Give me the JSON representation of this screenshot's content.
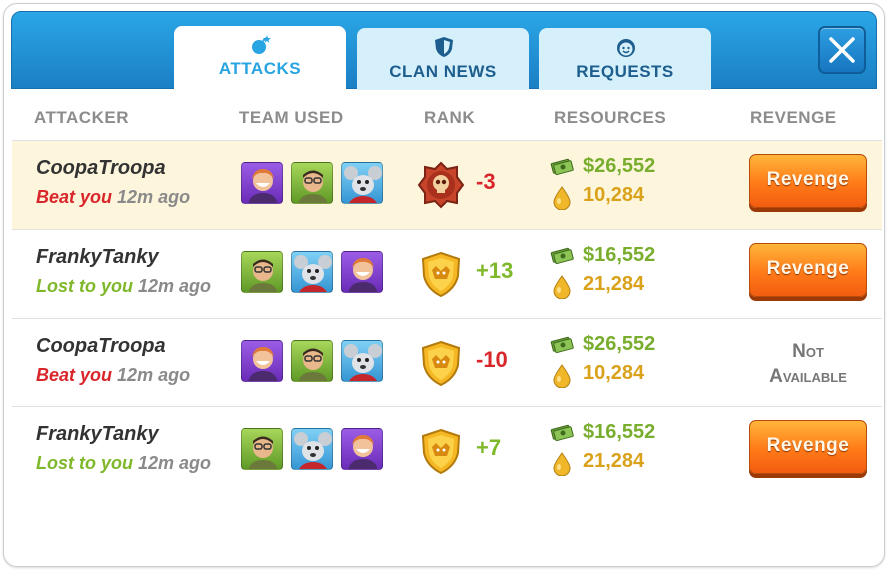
{
  "tabs": [
    {
      "label": "ATTACKS",
      "icon": "bomb-icon",
      "active": true
    },
    {
      "label": "CLAN NEWS",
      "icon": "shield-icon",
      "active": false
    },
    {
      "label": "REQUESTS",
      "icon": "face-icon",
      "active": false
    }
  ],
  "columns": {
    "attacker": "ATTACKER",
    "team_used": "TEAM USED",
    "rank": "RANK",
    "resources": "RESOURCES",
    "revenge": "REVENGE"
  },
  "rows": [
    {
      "name": "CoopaTroopa",
      "result": "Beat you",
      "ago": "12m ago",
      "team": [
        "purple-hero-avatar",
        "green-hero-avatar",
        "mouse-hero-avatar"
      ],
      "rank_icon": "skull-rank-icon",
      "rank_change": "-3",
      "cash": "$26,552",
      "elixir": "10,284",
      "revenge": "Revenge",
      "highlighted": true
    },
    {
      "name": "FrankyTanky",
      "result": "Lost to you",
      "ago": "12m ago",
      "team": [
        "green-hero-avatar",
        "mouse-hero-avatar",
        "purple-hero-avatar"
      ],
      "rank_icon": "gold-shield-rank-icon",
      "rank_change": "+13",
      "cash": "$16,552",
      "elixir": "21,284",
      "revenge": "Revenge",
      "highlighted": false
    },
    {
      "name": "CoopaTroopa",
      "result": "Beat you",
      "ago": "12m ago",
      "team": [
        "purple-hero-avatar",
        "green-hero-avatar",
        "mouse-hero-avatar"
      ],
      "rank_icon": "gold-shield-rank-icon",
      "rank_change": "-10",
      "cash": "$26,552",
      "elixir": "10,284",
      "revenge_unavailable": "Not Available",
      "highlighted": false
    },
    {
      "name": "FrankyTanky",
      "result": "Lost to you",
      "ago": "12m ago",
      "team": [
        "green-hero-avatar",
        "mouse-hero-avatar",
        "purple-hero-avatar"
      ],
      "rank_icon": "gold-shield-rank-icon",
      "rank_change": "+7",
      "cash": "$16,552",
      "elixir": "21,284",
      "revenge": "Revenge",
      "highlighted": false
    }
  ],
  "colors": {
    "header_blue": "#1b7fc4",
    "beat_red": "#d9262b",
    "lost_green": "#7fb82b",
    "gold": "#d9a21a",
    "revenge_orange": "#ff7a18",
    "highlight_row": "#fdf6dc"
  }
}
